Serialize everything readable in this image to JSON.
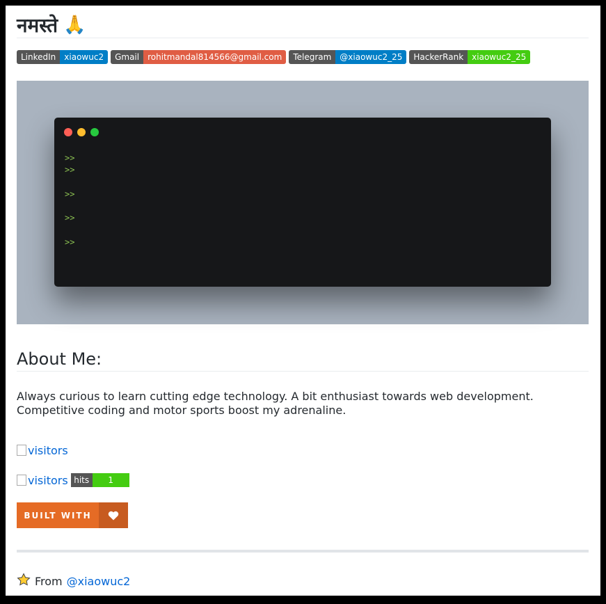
{
  "header": {
    "title": "नमस्ते",
    "title_emoji": "🙏"
  },
  "badges": [
    {
      "label": "LinkedIn",
      "value": "xiaowuc2",
      "color": "#007ec6"
    },
    {
      "label": "Gmail",
      "value": "rohitmandal814566@gmail.com",
      "color": "#e05d44"
    },
    {
      "label": "Telegram",
      "value": "@xiaowuc2_25",
      "color": "#007ec6"
    },
    {
      "label": "HackerRank",
      "value": "xiaowuc2_25",
      "color": "#4c1"
    }
  ],
  "terminal": {
    "dot_colors": [
      "#ff5f56",
      "#ffbd2e",
      "#27c93f"
    ],
    "prompt": ">>",
    "prompt_color": "#8cc152"
  },
  "about": {
    "heading": "About Me:",
    "text": "Always curious to learn cutting edge technology. A bit enthusiast towards web development. Competitive coding and motor sports boost my adrenaline."
  },
  "visitors": {
    "alt1": "visitors",
    "alt2": "visitors",
    "hits_label": "hits",
    "hits_value": "1"
  },
  "built_with": {
    "label": "BUILT WITH",
    "icon": "heart-icon"
  },
  "footer": {
    "from_text": "From",
    "handle": "@xiaowuc2",
    "icon": "star-icon"
  }
}
